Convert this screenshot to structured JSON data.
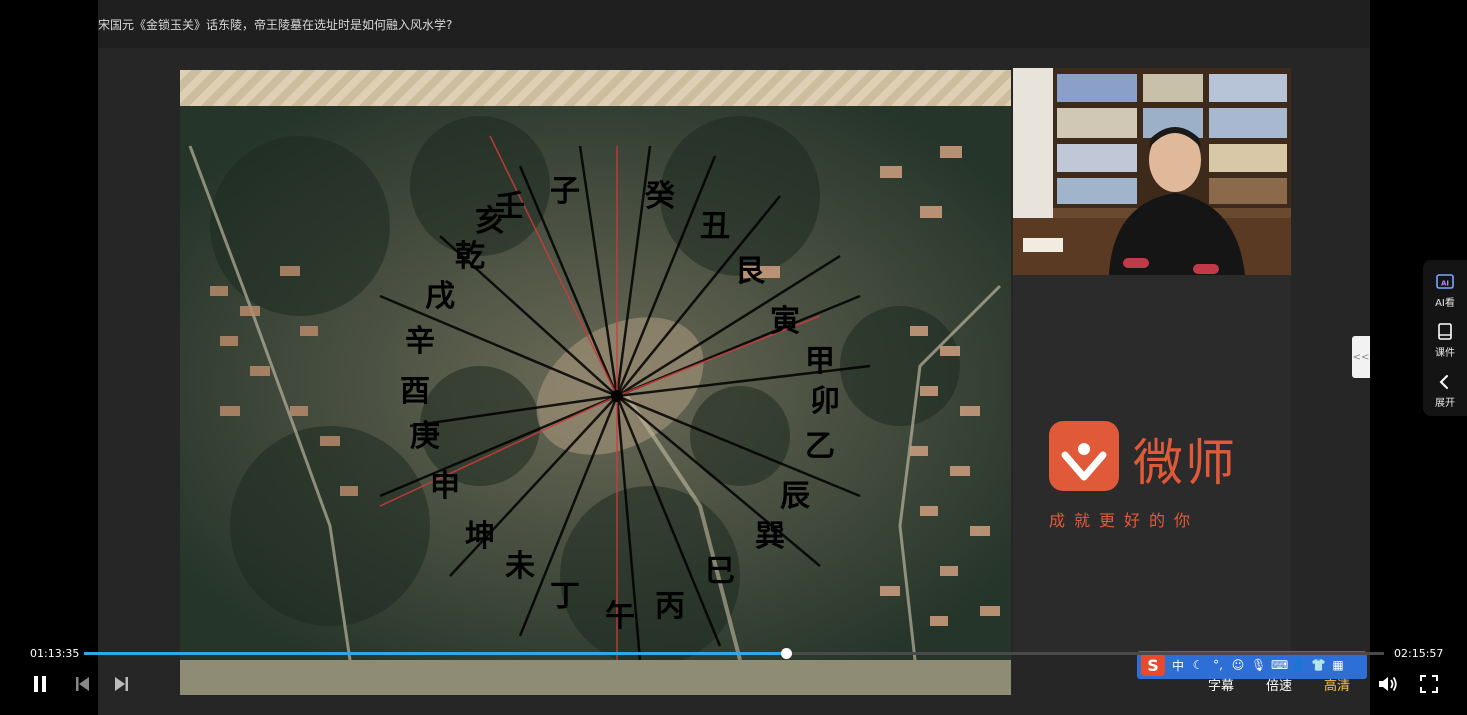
{
  "video": {
    "title": "宋国元《金锁玉关》话东陵，帝王陵墓在选址时是如何融入风水学?"
  },
  "slide": {
    "compass_labels": [
      "壬",
      "子",
      "癸",
      "丑",
      "艮",
      "寅",
      "甲",
      "卯",
      "乙",
      "辰",
      "巽",
      "巳",
      "丙",
      "午",
      "丁",
      "未",
      "坤",
      "申",
      "庚",
      "酉",
      "辛",
      "戌",
      "乾",
      "亥"
    ]
  },
  "brand": {
    "name": "微师",
    "slogan": "成就更好的你",
    "color": "#e05a3a"
  },
  "side_panel": {
    "ai_label": "AI看",
    "courseware_label": "课件",
    "expand_label": "展开"
  },
  "collapse_tab": {
    "label": "<<"
  },
  "ime": {
    "logo": "S",
    "lang": "中"
  },
  "player": {
    "current_time": "01:13:35",
    "total_time": "02:15:57",
    "progress_fraction": 0.54,
    "accent": "#2da8e8",
    "subtitle_label": "字幕",
    "speed_label": "倍速",
    "quality_label": "高清",
    "quality_color": "#f5c342"
  }
}
